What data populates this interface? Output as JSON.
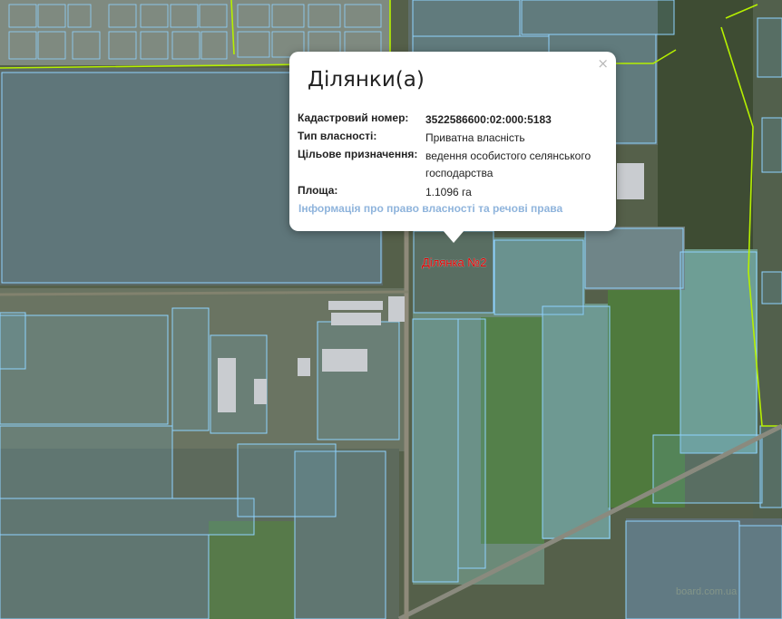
{
  "popup": {
    "title": "Ділянки(а)",
    "close_symbol": "×",
    "fields": [
      {
        "label": "Кадастровий номер:",
        "value": "3522586600:02:000:5183"
      },
      {
        "label": "Тип власності:",
        "value": "Приватна власність"
      },
      {
        "label": "Цільове призначення:",
        "value": "ведення особистого селянського господарства"
      },
      {
        "label": "Площа:",
        "value": "1.1096 га"
      }
    ],
    "link_text": "Інформація про право власності та речові права"
  },
  "map": {
    "parcel_label": "Ділянка №2",
    "watermark": "board.com.ua",
    "colors": {
      "boundary": "#8fd3ff",
      "admin_boundary": "#b6f000",
      "label": "#e00000",
      "parcel_fill": "#6fb0d0"
    }
  }
}
